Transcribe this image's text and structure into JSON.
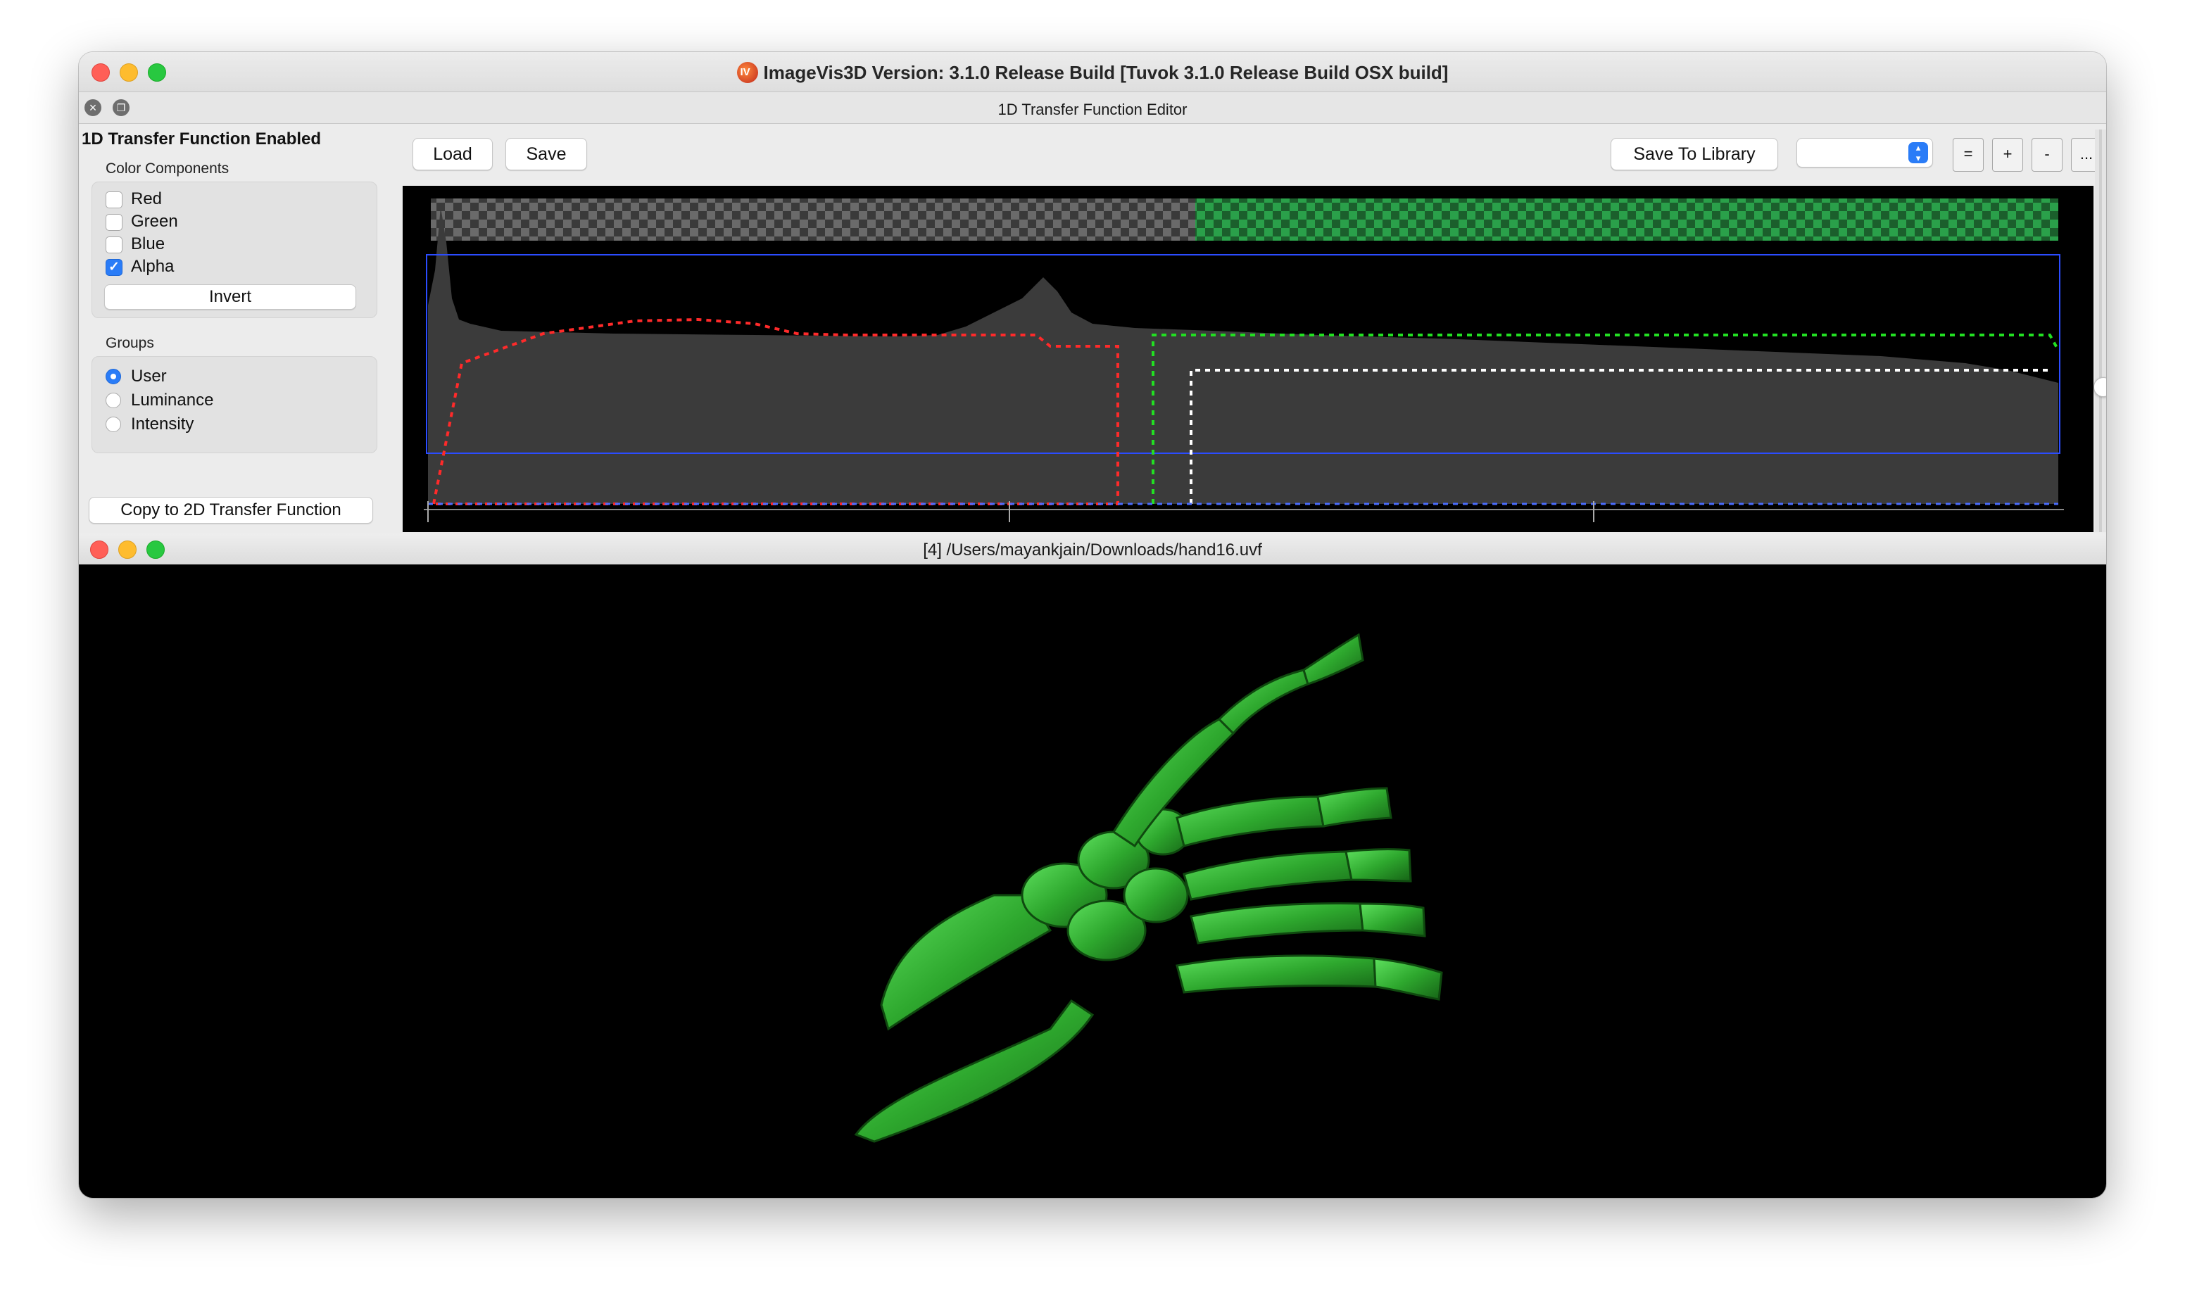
{
  "window": {
    "title": "ImageVis3D Version: 3.1.0 Release Build [Tuvok 3.1.0 Release Build OSX build]",
    "app_icon": "imagevis3d-app-icon"
  },
  "dock": {
    "title": "1D Transfer Function Editor",
    "close_icon": "close-icon",
    "float_icon": "float-icon"
  },
  "left_panel": {
    "enabled_label": "1D Transfer Function Enabled",
    "color_components": {
      "title": "Color Components",
      "items": [
        {
          "label": "Red",
          "checked": false
        },
        {
          "label": "Green",
          "checked": false
        },
        {
          "label": "Blue",
          "checked": false
        },
        {
          "label": "Alpha",
          "checked": true
        }
      ],
      "invert_label": "Invert"
    },
    "groups": {
      "title": "Groups",
      "items": [
        {
          "label": "User",
          "selected": true
        },
        {
          "label": "Luminance",
          "selected": false
        },
        {
          "label": "Intensity",
          "selected": false
        }
      ]
    },
    "copy_button": "Copy to 2D Transfer Function"
  },
  "toolbar": {
    "load_label": "Load",
    "save_label": "Save",
    "save_to_library_label": "Save To Library",
    "library_select_value": "",
    "equals_label": "=",
    "plus_label": "+",
    "minus_label": "-",
    "more_label": "..."
  },
  "render_window": {
    "title": "[4] /Users/mayankjain/Downloads/hand16.uvf",
    "content": "green-hand-skeleton-volume-render"
  },
  "colors": {
    "close": "#ff5f57",
    "minimize": "#febc2e",
    "maximize": "#28c840",
    "accent": "#2a7cf7",
    "red_curve": "#ff2a2a",
    "green_curve": "#22e022",
    "alpha_curve": "#ffffff",
    "bone_green": "#2ea82e"
  }
}
